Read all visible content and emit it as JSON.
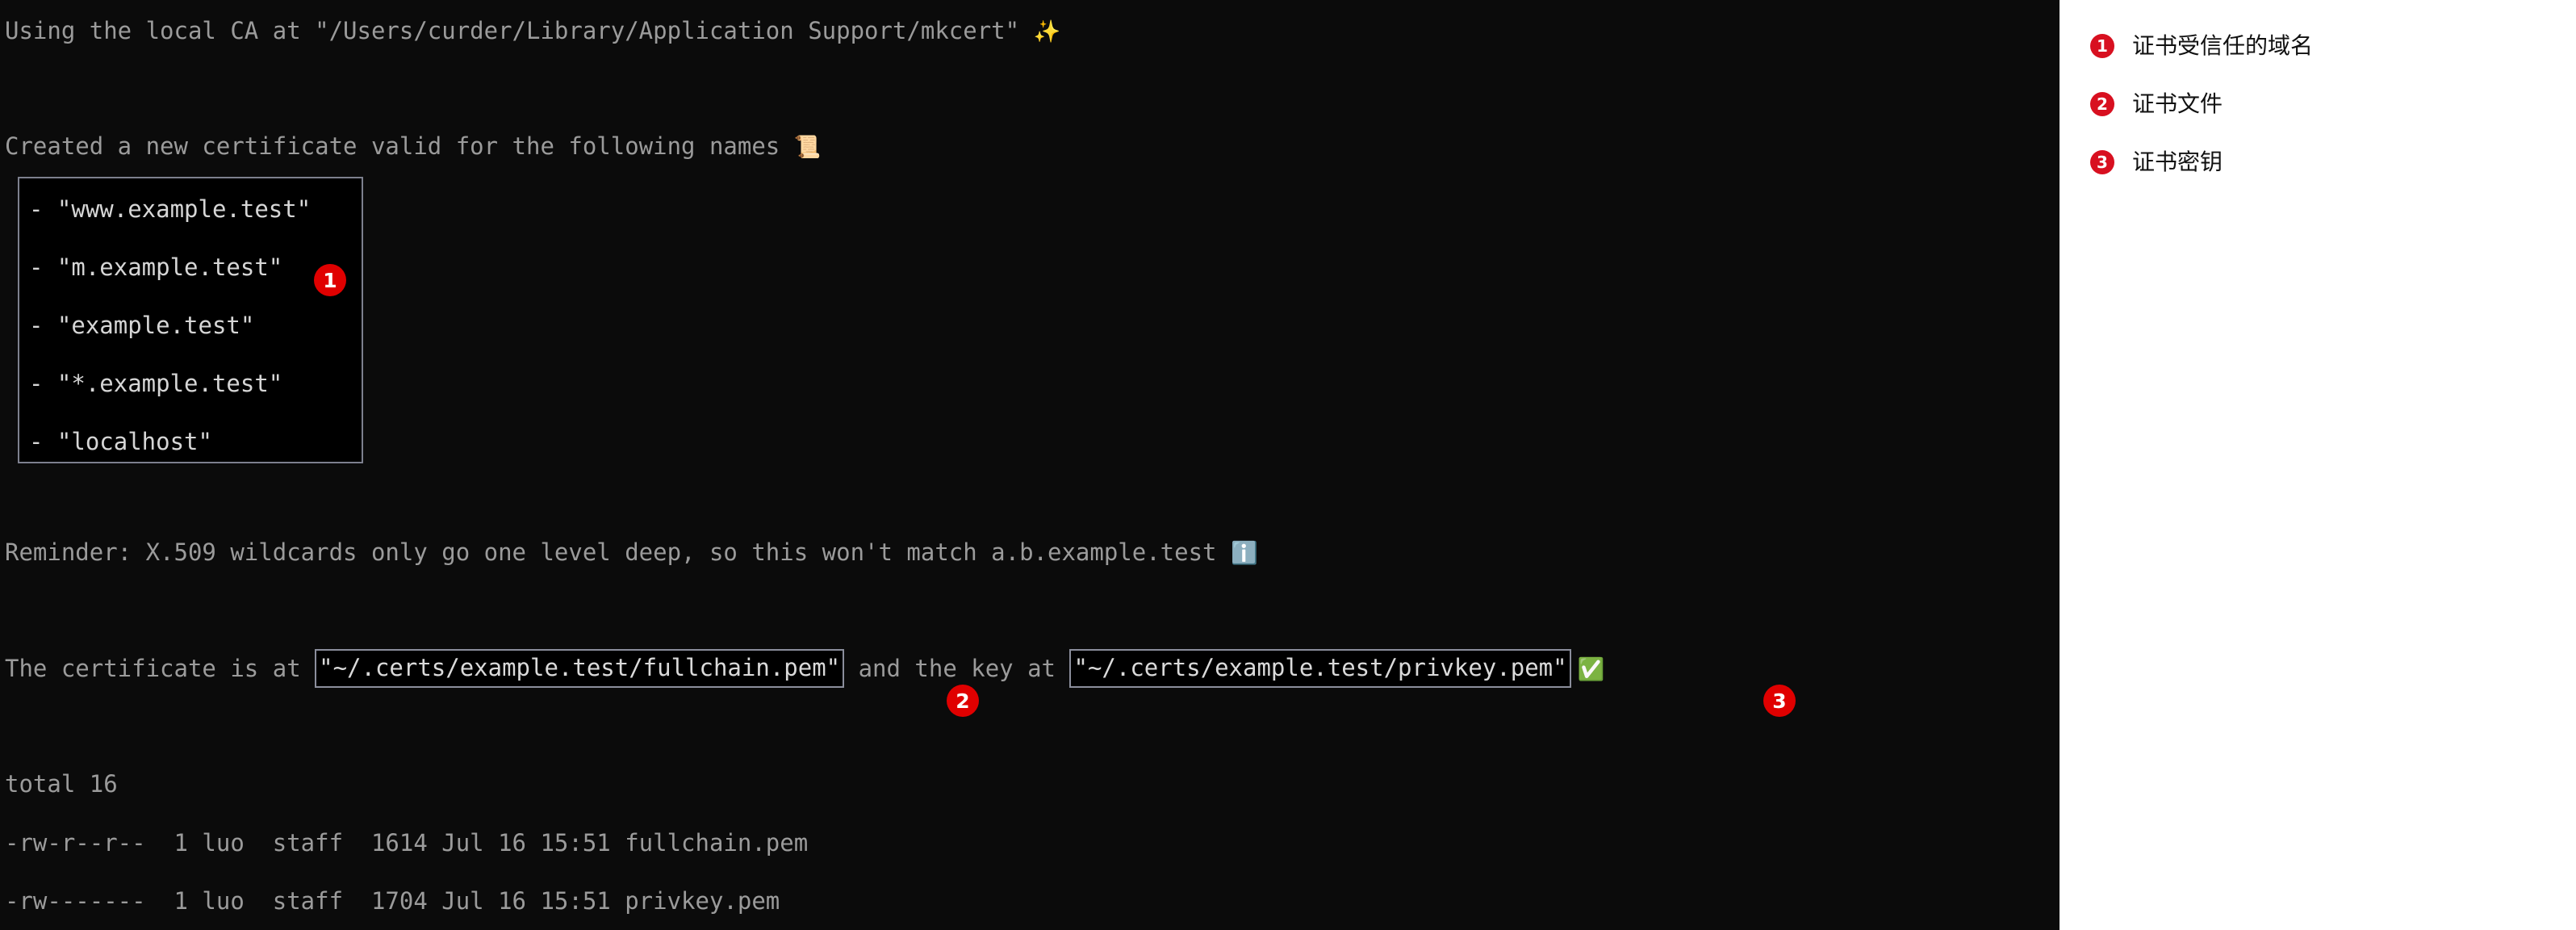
{
  "terminal": {
    "background_color": "#0b0b0b",
    "text_color": "#9b9b9b",
    "highlight_text_color": "#dadada",
    "lines": {
      "ca_line_prefix": "Using the local CA at \"/Users/curder/Library/Application Support/mkcert\" ",
      "ca_line_emoji": "✨",
      "created_line_prefix": "Created a new certificate valid for the following names ",
      "created_line_emoji": "📜",
      "reminder_prefix": "Reminder: X.509 wildcards only go one level deep, so this won't match a.b.example.test ",
      "reminder_emoji": "ℹ️",
      "cert_prefix": "The certificate is at ",
      "cert_path": "\"~/.certs/example.test/fullchain.pem\"",
      "cert_middle": " and the key at ",
      "key_path": "\"~/.certs/example.test/privkey.pem\"",
      "cert_suffix_emoji": "✅",
      "total_line": "total 16",
      "ls_fullchain": "-rw-r--r--  1 luo  staff  1614 Jul 16 15:51 fullchain.pem",
      "ls_privkey": "-rw-------  1 luo  staff  1704 Jul 16 15:51 privkey.pem"
    },
    "san_list": [
      "- \"www.example.test\"",
      "- \"m.example.test\"",
      "- \"example.test\"",
      "- \"*.example.test\"",
      "- \"localhost\""
    ],
    "badges": {
      "one": "1",
      "two": "2",
      "three": "3"
    },
    "badge_color": "#e00000"
  },
  "sidebar": {
    "background_color": "#ffffff",
    "badge_color": "#d81020",
    "items": [
      {
        "number": "1",
        "label": "证书受信任的域名"
      },
      {
        "number": "2",
        "label": "证书文件"
      },
      {
        "number": "3",
        "label": "证书密钥"
      }
    ]
  }
}
